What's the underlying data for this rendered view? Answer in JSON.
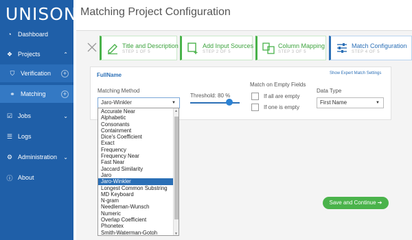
{
  "brand": {
    "logo_text": "UNISON"
  },
  "sidebar": {
    "items": [
      {
        "label": "Dashboard",
        "icon": "gauge-icon"
      },
      {
        "label": "Projects",
        "icon": "cubes-icon"
      },
      {
        "label": "Verification",
        "icon": "shield-check-icon"
      },
      {
        "label": "Matching",
        "icon": "links-icon"
      },
      {
        "label": "Jobs",
        "icon": "check-square-icon"
      },
      {
        "label": "Logs",
        "icon": "list-icon"
      },
      {
        "label": "Administration",
        "icon": "sliders-icon"
      },
      {
        "label": "About",
        "icon": "info-circle-icon"
      }
    ]
  },
  "page": {
    "title": "Matching Project Configuration"
  },
  "steps": [
    {
      "title": "Title and Description",
      "sub": "STEP 1 OF 5"
    },
    {
      "title": "Add Input Sources",
      "sub": "STEP 2 OF 5"
    },
    {
      "title": "Column Mapping",
      "sub": "STEP 3 OF 5"
    },
    {
      "title": "Match Configuration",
      "sub": "STEP 4 OF 5"
    }
  ],
  "match_card": {
    "field_name": "FullName",
    "expert_link": "Show Expert Match Settings",
    "method_label": "Matching Method",
    "method_value": "Jaro-Winkler",
    "threshold_label": "Threshold: 80 %",
    "threshold_value": 80,
    "empty_label": "Match on Empty Fields",
    "empty_all": "If all are empty",
    "empty_one": "If one is empty",
    "datatype_label": "Data Type",
    "datatype_value": "First Name"
  },
  "method_options": [
    "Accurate Near",
    "Alphabetic",
    "Consonants",
    "Containment",
    "Dice's Coefficient",
    "Exact",
    "Frequency",
    "Frequency Near",
    "Fast Near",
    "Jaccard Similarity",
    "Jaro",
    "Jaro-Winkler",
    "Longest Common Substring",
    "MD Keyboard",
    "N-gram",
    "Needleman-Wunsch",
    "Numeric",
    "Overlap Coefficient",
    "Phonetex",
    "Smith-Waterman-Gotoh"
  ],
  "actions": {
    "save_label": "Save and Continue"
  },
  "colors": {
    "sidebar": "#1f5fa8",
    "accent_green": "#4ab34b",
    "accent_blue": "#2b6fb6"
  }
}
